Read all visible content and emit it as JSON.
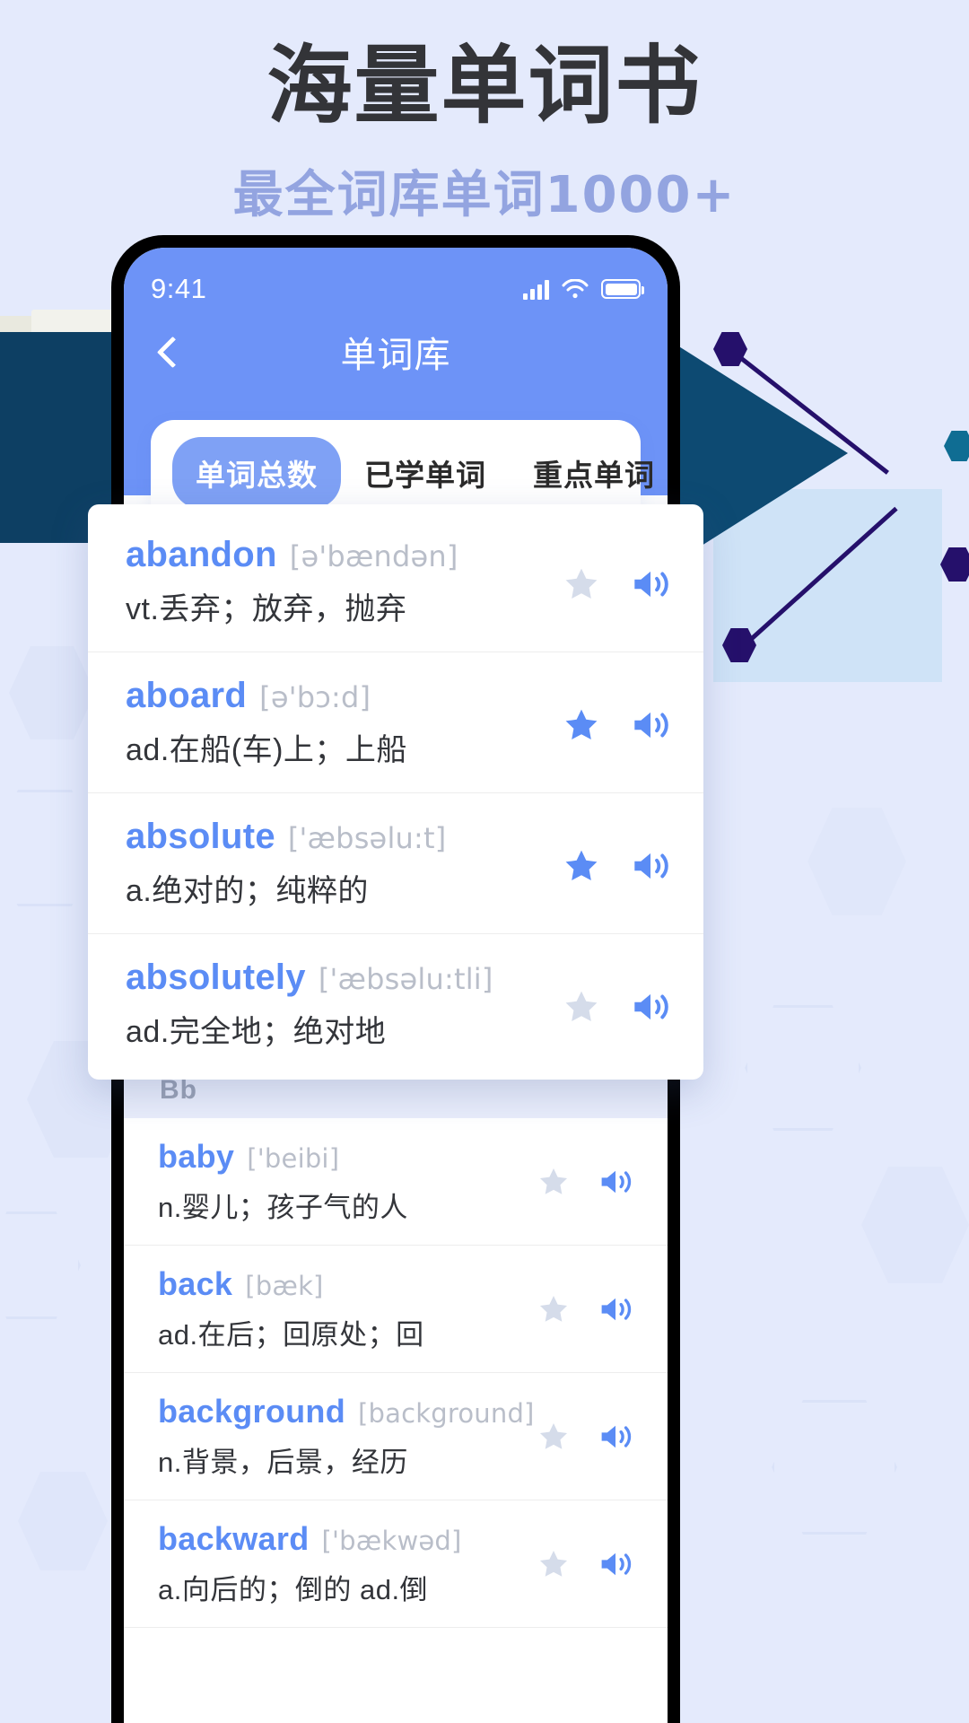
{
  "promo": {
    "headline": "海量单词书",
    "subheadline": "最全词库单词1000+"
  },
  "phone": {
    "status": {
      "time": "9:41",
      "signal_icon": "signal-bars-icon",
      "wifi_icon": "wifi-icon",
      "battery_icon": "battery-icon"
    },
    "nav": {
      "back_icon": "back-chevron-icon",
      "title": "单词库"
    },
    "tabs": [
      {
        "label": "单词总数",
        "active": true
      },
      {
        "label": "已学单词",
        "active": false
      },
      {
        "label": "重点单词",
        "active": false
      }
    ]
  },
  "overlay_list": [
    {
      "word": "abandon",
      "phonetic": "[ə'bændən]",
      "definition": "vt.丢弃；放弃，抛弃",
      "starred": false,
      "star_icon": "star-icon",
      "speaker_icon": "speaker-icon"
    },
    {
      "word": "aboard",
      "phonetic": "[ə'bɔ:d]",
      "definition": "ad.在船(车)上；上船",
      "starred": true,
      "star_icon": "star-icon",
      "speaker_icon": "speaker-icon"
    },
    {
      "word": "absolute",
      "phonetic": "['æbsəlu:t]",
      "definition": "a.绝对的；纯粹的",
      "starred": true,
      "star_icon": "star-icon",
      "speaker_icon": "speaker-icon"
    },
    {
      "word": "absolutely",
      "phonetic": "['æbsəlu:tli]",
      "definition": "ad.完全地；绝对地",
      "starred": false,
      "star_icon": "star-icon",
      "speaker_icon": "speaker-icon"
    }
  ],
  "sections": [
    {
      "letter": "Bb",
      "words": [
        {
          "word": "baby",
          "phonetic": "['beibi]",
          "definition": "n.婴儿；孩子气的人",
          "starred": false,
          "star_icon": "star-icon",
          "speaker_icon": "speaker-icon"
        },
        {
          "word": "back",
          "phonetic": "[bæk]",
          "definition": "ad.在后；回原处；回",
          "starred": false,
          "star_icon": "star-icon",
          "speaker_icon": "speaker-icon"
        },
        {
          "word": "background",
          "phonetic": "[background]",
          "definition": "n.背景，后景，经历",
          "starred": false,
          "star_icon": "star-icon",
          "speaker_icon": "speaker-icon"
        },
        {
          "word": "backward",
          "phonetic": "['bækwəd]",
          "definition": "a.向后的；倒的 ad.倒",
          "starred": false,
          "star_icon": "star-icon",
          "speaker_icon": "speaker-icon"
        }
      ]
    }
  ],
  "colors": {
    "page_bg": "#e4eafc",
    "headline": "#333438",
    "subheadline": "#93a4e0",
    "app_blue": "#6d93f7",
    "tab_active": "#7fa1f5",
    "word_blue": "#5b8cf5",
    "phonetic_gray": "#b9bec9",
    "star_active": "#5b8cf5",
    "star_inactive": "#d5dcea",
    "navy": "#25106b",
    "deep_blue": "#0d4a72",
    "light_blue_square": "#cfe3f7"
  }
}
